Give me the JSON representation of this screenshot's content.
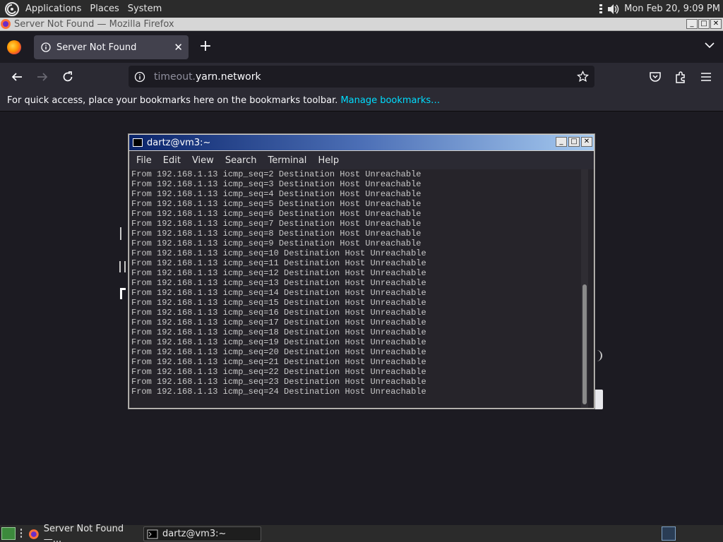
{
  "top_panel": {
    "menus": [
      "Applications",
      "Places",
      "System"
    ],
    "clock": "Mon Feb 20,  9:09 PM"
  },
  "firefox": {
    "window_title": "Server Not Found — Mozilla Firefox",
    "tab_title": "Server Not Found",
    "url_prefix": "timeout.",
    "url_host": "yarn.network",
    "bookmarks_message": "For quick access, place your bookmarks here on the bookmarks toolbar.",
    "bookmarks_link": "Manage bookmarks…"
  },
  "terminal": {
    "title": "dartz@vm3:~",
    "menus": [
      "File",
      "Edit",
      "View",
      "Search",
      "Terminal",
      "Help"
    ],
    "lines": [
      "From 192.168.1.13 icmp_seq=2 Destination Host Unreachable",
      "From 192.168.1.13 icmp_seq=3 Destination Host Unreachable",
      "From 192.168.1.13 icmp_seq=4 Destination Host Unreachable",
      "From 192.168.1.13 icmp_seq=5 Destination Host Unreachable",
      "From 192.168.1.13 icmp_seq=6 Destination Host Unreachable",
      "From 192.168.1.13 icmp_seq=7 Destination Host Unreachable",
      "From 192.168.1.13 icmp_seq=8 Destination Host Unreachable",
      "From 192.168.1.13 icmp_seq=9 Destination Host Unreachable",
      "From 192.168.1.13 icmp_seq=10 Destination Host Unreachable",
      "From 192.168.1.13 icmp_seq=11 Destination Host Unreachable",
      "From 192.168.1.13 icmp_seq=12 Destination Host Unreachable",
      "From 192.168.1.13 icmp_seq=13 Destination Host Unreachable",
      "From 192.168.1.13 icmp_seq=14 Destination Host Unreachable",
      "From 192.168.1.13 icmp_seq=15 Destination Host Unreachable",
      "From 192.168.1.13 icmp_seq=16 Destination Host Unreachable",
      "From 192.168.1.13 icmp_seq=17 Destination Host Unreachable",
      "From 192.168.1.13 icmp_seq=18 Destination Host Unreachable",
      "From 192.168.1.13 icmp_seq=19 Destination Host Unreachable",
      "From 192.168.1.13 icmp_seq=20 Destination Host Unreachable",
      "From 192.168.1.13 icmp_seq=21 Destination Host Unreachable",
      "From 192.168.1.13 icmp_seq=22 Destination Host Unreachable",
      "From 192.168.1.13 icmp_seq=23 Destination Host Unreachable",
      "From 192.168.1.13 icmp_seq=24 Destination Host Unreachable"
    ]
  },
  "taskbar": {
    "tasks": [
      "Server Not Found —...",
      "dartz@vm3:~"
    ]
  },
  "window_buttons": {
    "minimize": "_",
    "maximize": "□",
    "close": "✕"
  },
  "icons": {
    "new_tab": "+",
    "tab_close": "✕"
  },
  "colors": {
    "firefox_dark": "#1c1b22",
    "toolbar": "#2b2a33",
    "link": "#00ddff",
    "terminal_bg": "#26242a",
    "terminal_title": "#0a246a"
  }
}
